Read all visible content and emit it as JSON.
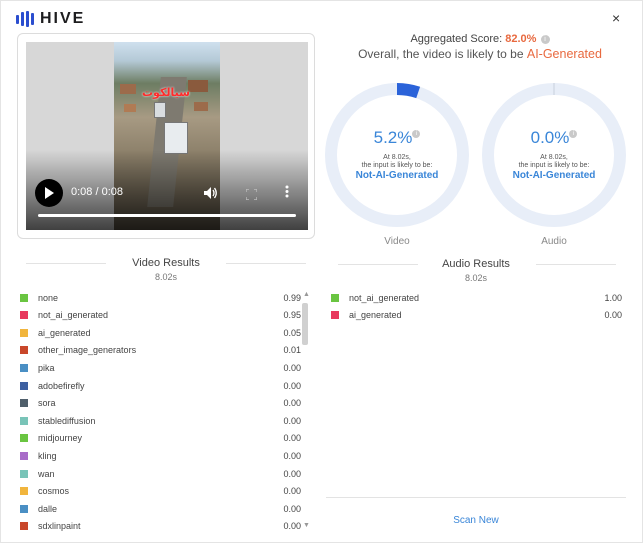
{
  "brand": {
    "name": "HIVE"
  },
  "header": {
    "close_label": "×"
  },
  "video_player": {
    "time": "0:08 / 0:08",
    "progress": 1.0,
    "overlay_text": "سيالكوت"
  },
  "summary": {
    "aggregated_label": "Aggregated Score:",
    "aggregated_value": "82.0%",
    "overall_prefix": "Overall, the video is likely to be",
    "overall_verdict": "AI-Generated",
    "verdict_color": "#e8693f"
  },
  "gauges": {
    "video": {
      "percent": "5.2%",
      "fraction": 0.052,
      "at_line1": "At 8.02s,",
      "at_line2": "the input is likely to be:",
      "verdict": "Not-AI-Generated",
      "caption": "Video"
    },
    "audio": {
      "percent": "0.0%",
      "fraction": 0.0,
      "at_line1": "At 8.02s,",
      "at_line2": "the input is likely to be:",
      "verdict": "Not-AI-Generated",
      "caption": "Audio"
    }
  },
  "video_results": {
    "title": "Video Results",
    "time": "8.02s",
    "rows": [
      {
        "name": "none",
        "value": "0.99",
        "color": "#6ac541"
      },
      {
        "name": "not_ai_generated",
        "value": "0.95",
        "color": "#e8395e"
      },
      {
        "name": "ai_generated",
        "value": "0.05",
        "color": "#f1b53d"
      },
      {
        "name": "other_image_generators",
        "value": "0.01",
        "color": "#c9472a"
      },
      {
        "name": "pika",
        "value": "0.00",
        "color": "#4a8fc4"
      },
      {
        "name": "adobefirefly",
        "value": "0.00",
        "color": "#3d5fa0"
      },
      {
        "name": "sora",
        "value": "0.00",
        "color": "#4f5f6b"
      },
      {
        "name": "stablediffusion",
        "value": "0.00",
        "color": "#79c4b8"
      },
      {
        "name": "midjourney",
        "value": "0.00",
        "color": "#6ac541"
      },
      {
        "name": "kling",
        "value": "0.00",
        "color": "#a86cc8"
      },
      {
        "name": "wan",
        "value": "0.00",
        "color": "#79c4b8"
      },
      {
        "name": "cosmos",
        "value": "0.00",
        "color": "#f1b53d"
      },
      {
        "name": "dalle",
        "value": "0.00",
        "color": "#4a8fc4"
      },
      {
        "name": "sdxlinpaint",
        "value": "0.00",
        "color": "#c9472a"
      }
    ]
  },
  "audio_results": {
    "title": "Audio Results",
    "time": "8.02s",
    "rows": [
      {
        "name": "not_ai_generated",
        "value": "1.00",
        "color": "#6ac541"
      },
      {
        "name": "ai_generated",
        "value": "0.00",
        "color": "#e8395e"
      }
    ]
  },
  "footer": {
    "scan_new": "Scan New"
  },
  "colors": {
    "accent": "#3a86d8",
    "gauge_track": "#e8eef8",
    "gauge_fill": "#2b63d9",
    "verdict_ai": "#e8693f"
  }
}
